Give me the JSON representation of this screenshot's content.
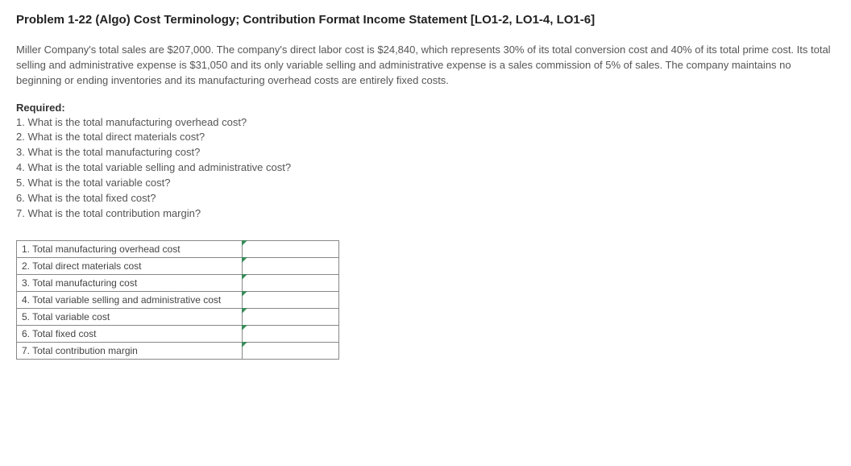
{
  "title": "Problem 1-22 (Algo) Cost Terminology; Contribution Format Income Statement [LO1-2, LO1-4, LO1-6]",
  "description": "Miller Company's total sales are $207,000. The company's direct labor cost is $24,840, which represents 30% of its total conversion cost and 40% of its total prime cost. Its total selling and administrative expense is $31,050 and its only variable selling and administrative expense is a sales commission of 5% of sales. The company maintains no beginning or ending inventories and its manufacturing overhead costs are entirely fixed costs.",
  "required_label": "Required:",
  "questions": [
    "1. What is the total manufacturing overhead cost?",
    "2. What is the total direct materials cost?",
    "3. What is the total manufacturing cost?",
    "4. What is the total variable selling and administrative cost?",
    "5. What is the total variable cost?",
    "6. What is the total fixed cost?",
    "7. What is the total contribution margin?"
  ],
  "table_rows": [
    {
      "label": "1. Total manufacturing overhead cost",
      "value": ""
    },
    {
      "label": "2. Total direct materials cost",
      "value": ""
    },
    {
      "label": "3. Total manufacturing cost",
      "value": ""
    },
    {
      "label": "4. Total variable selling and administrative cost",
      "value": ""
    },
    {
      "label": "5. Total variable cost",
      "value": ""
    },
    {
      "label": "6. Total fixed cost",
      "value": ""
    },
    {
      "label": "7. Total contribution margin",
      "value": ""
    }
  ]
}
